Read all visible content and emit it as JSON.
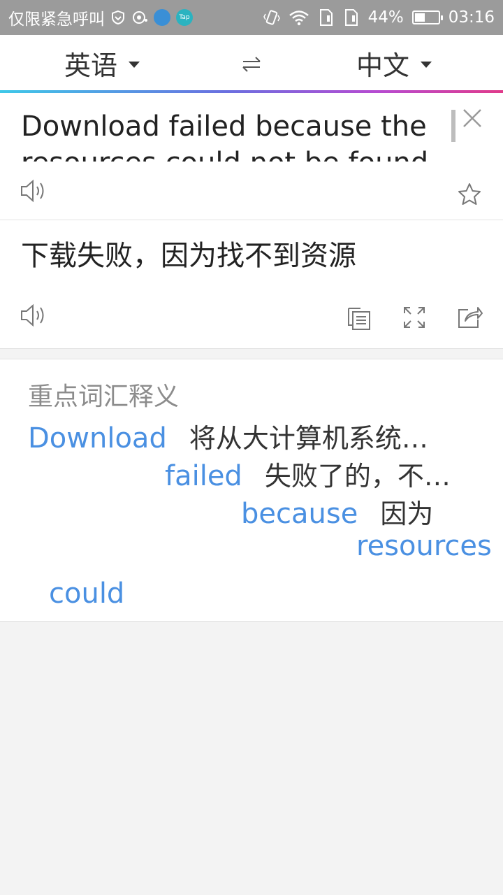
{
  "status_bar": {
    "carrier_text": "仅限紧急呼叫",
    "tap_badge": "Tap",
    "battery_percent_text": "44%",
    "battery_level": 0.44,
    "time": "03:16",
    "icons": [
      "shield-icon",
      "eye-icon",
      "app-badge-icon",
      "tap-badge-icon",
      "vibrate-icon",
      "wifi-icon",
      "sim-card-icon",
      "sim-card-icon",
      "battery-icon"
    ]
  },
  "lang_bar": {
    "source_language": "英语",
    "target_language": "中文",
    "swap_icon": "swap-arrows-icon"
  },
  "source": {
    "text": "Download failed because the resources could not be found",
    "icons": [
      "clear-icon",
      "speaker-icon",
      "star-icon"
    ]
  },
  "result": {
    "text": "下载失败，因为找不到资源",
    "icons": [
      "speaker-icon",
      "copy-icon",
      "expand-icon",
      "share-icon"
    ]
  },
  "vocab": {
    "title": "重点词汇释义",
    "items": [
      {
        "word": "Download",
        "meaning": "将从大计算机系统…"
      },
      {
        "word": "failed",
        "meaning": "失败了的，不…"
      },
      {
        "word": "because",
        "meaning": "因为"
      },
      {
        "word": "resources",
        "meaning": ""
      },
      {
        "word": "could",
        "meaning": ""
      }
    ]
  },
  "colors": {
    "status_bar": "#9b9b9b",
    "accent_blue": "#4a90e2",
    "gradient": [
      "#3ec8e8",
      "#6a6fe0",
      "#b64bd1",
      "#e03a8a"
    ],
    "background": "#f3f3f3"
  }
}
